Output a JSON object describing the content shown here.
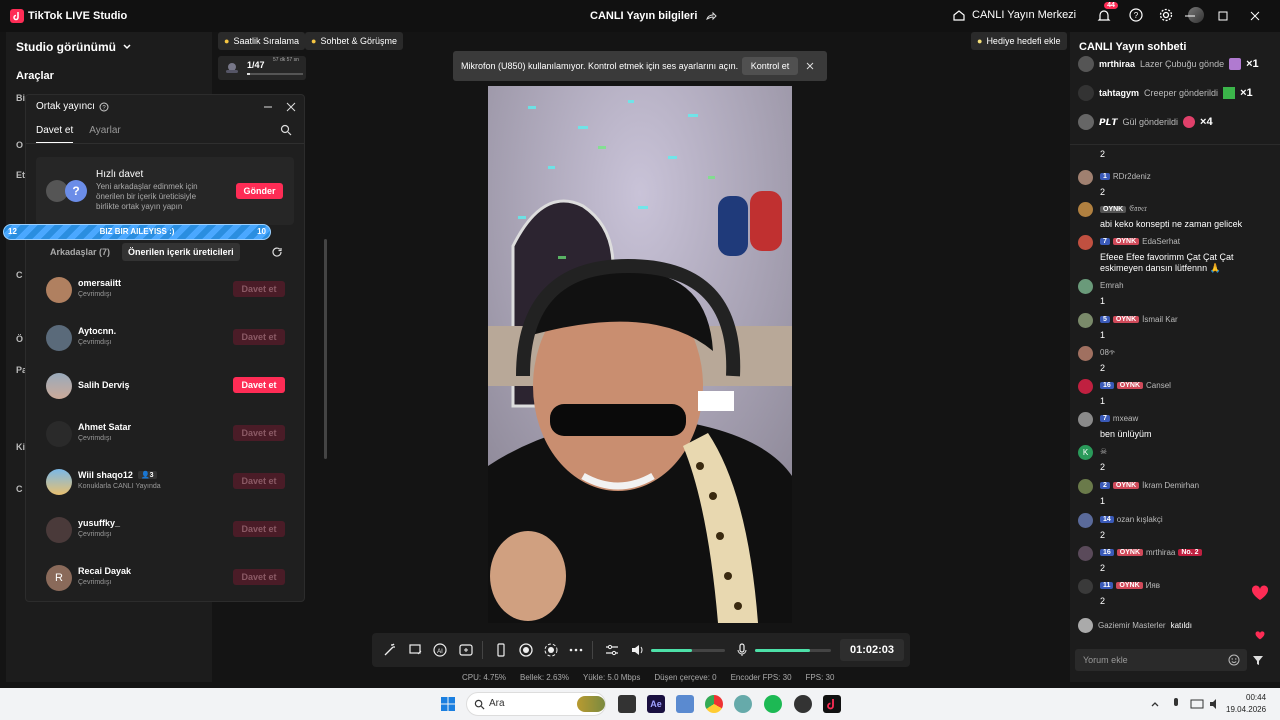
{
  "titlebar": {
    "app_name": "TikTok LIVE Studio",
    "center_title": "CANLI Yayın bilgileri",
    "live_center": "CANLI Yayın Merkezi",
    "notif_count": "44"
  },
  "left_panel": {
    "heading": "Studio görünümü",
    "tools": "Araçlar",
    "fragments": [
      "Bi",
      "O",
      "Et",
      "C",
      "Ö",
      "Pa",
      "Ki",
      "C"
    ]
  },
  "top_tags": {
    "ranking": "Saatlik Sıralama",
    "chat_call": "Sohbet & Görüşme",
    "gift_goal": "Hediye hedefi ekle",
    "viewer_count": "1/47",
    "viewer_time": "57 dk 57 sn"
  },
  "toast": {
    "message": "Mikrofon (U850) kullanılamıyor. Kontrol etmek için ses ayarlarını açın.",
    "button": "Kontrol et"
  },
  "cohost": {
    "title": "Ortak yayıncı",
    "tabs": [
      "Davet et",
      "Ayarlar"
    ],
    "quick_title": "Hızlı davet",
    "quick_desc": "Yeni arkadaşlar edinmek için önerilen bir içerik üreticisiyle birlikte ortak yayın yapın",
    "send_button": "Gönder",
    "filter_friends": "Arkadaşlar (7)",
    "filter_suggested": "Önerilen içerik üreticileri",
    "friends": [
      {
        "name": "omersaiitt",
        "status": "Çevrimdışı",
        "button": "Davet et",
        "active": false
      },
      {
        "name": "Aytocnn.",
        "status": "Çevrimdışı",
        "button": "Davet et",
        "active": false
      },
      {
        "name": "Salih Derviş",
        "status": "",
        "button": "Davet et",
        "active": true
      },
      {
        "name": "Ahmet Satar",
        "status": "Çevrimdışı",
        "button": "Davet et",
        "active": false
      },
      {
        "name": "Wiil shaqo12",
        "status": "Konuklarla CANLI Yayında",
        "badge": "3",
        "button": "Davet et",
        "active": false
      },
      {
        "name": "yusuffky_",
        "status": "Çevrimdışı",
        "button": "Davet et",
        "active": false
      },
      {
        "name": "Recai Dayak",
        "status": "Çevrimdışı",
        "button": "Davet et",
        "active": false,
        "initial": "R"
      }
    ]
  },
  "team_bar": {
    "left": "12",
    "label": "BIZ BIR AILEYISS :)",
    "right": "10"
  },
  "controls": {
    "timer": "01:02:03",
    "speaker_level": 0.55,
    "mic_level": 0.72
  },
  "stats": {
    "cpu": "CPU: 4.75%",
    "memory": "Bellek: 2.63%",
    "upload": "Yükle: 5.0 Mbps",
    "dropped": "Düşen çerçeve: 0",
    "encoder_fps": "Encoder FPS: 30",
    "fps": "FPS: 30"
  },
  "chat": {
    "title": "CANLI Yayın sohbeti",
    "gifts": [
      {
        "name": "mrthiraa",
        "text": "Lazer Çubuğu gönde",
        "mult": "×1",
        "color": "#b07ad0"
      },
      {
        "name": "tahtagym",
        "text": "Creeper gönderildi",
        "mult": "×1",
        "color": "#3bb54a"
      },
      {
        "name": "𝙋𝙇𝙏",
        "text": "Gül gönderildi",
        "mult": "×4",
        "color": "#e0406a"
      }
    ],
    "messages": [
      {
        "level": "",
        "fan": "",
        "user": "",
        "body": "2",
        "color": "#666"
      },
      {
        "level": "1",
        "fan": "",
        "user": "RDr2deniz",
        "body": "2",
        "color": "#a08070"
      },
      {
        "level": "",
        "fan": "",
        "gray": "OYNK",
        "user": "𝔈𝔞𝔳𝔢𝔯",
        "body": "abi keko konsepti ne zaman gelicek",
        "color": "#b08040"
      },
      {
        "level": "7",
        "fan": "OYNK",
        "user": "EdaSerhat",
        "body": "Efeee Efee favorimm Çat Çat Çat eskimeyen dansın lütfennn 🙏",
        "color": "#c05040"
      },
      {
        "level": "",
        "fan": "",
        "user": "Emrah",
        "body": "1",
        "color": "#6a9a7a"
      },
      {
        "level": "5",
        "fan": "OYNK",
        "user": "İsmail Kar",
        "body": "1",
        "color": "#7a8a6a"
      },
      {
        "level": "",
        "fan": "",
        "user": "08ጥ",
        "body": "2",
        "color": "#a07060"
      },
      {
        "level": "16",
        "fan": "OYNK",
        "user": "Cansel",
        "body": "1",
        "color": "#c02040"
      },
      {
        "level": "7",
        "fan": "",
        "user": "mxeaw",
        "body": "ben ünlüyüm",
        "color": "#8a8a8a"
      },
      {
        "level": "",
        "fan": "",
        "user": "☠",
        "body": "2",
        "color": "#2a9a5a",
        "initial": "K"
      },
      {
        "level": "2",
        "fan": "OYNK",
        "user": "İkram Demirhan",
        "body": "1",
        "color": "#6a7a4a"
      },
      {
        "level": "14",
        "fan": "",
        "user": "ozan kışlakçi",
        "body": "2",
        "color": "#5a6a9a"
      },
      {
        "level": "16",
        "fan": "OYNK",
        "user": "mrthiraa",
        "no2": "No. 2",
        "body": "2",
        "color": "#5a4a5a"
      },
      {
        "level": "11",
        "fan": "OYNK",
        "user": "Ияв",
        "body": "2",
        "color": "#3a3a3a"
      }
    ],
    "joined_user": "Gaziemir Masterler",
    "joined_text": "katıldı",
    "input_placeholder": "Yorum ekle"
  },
  "taskbar": {
    "search_placeholder": "Ara",
    "time": "00:44",
    "date": "19.04.2026"
  }
}
